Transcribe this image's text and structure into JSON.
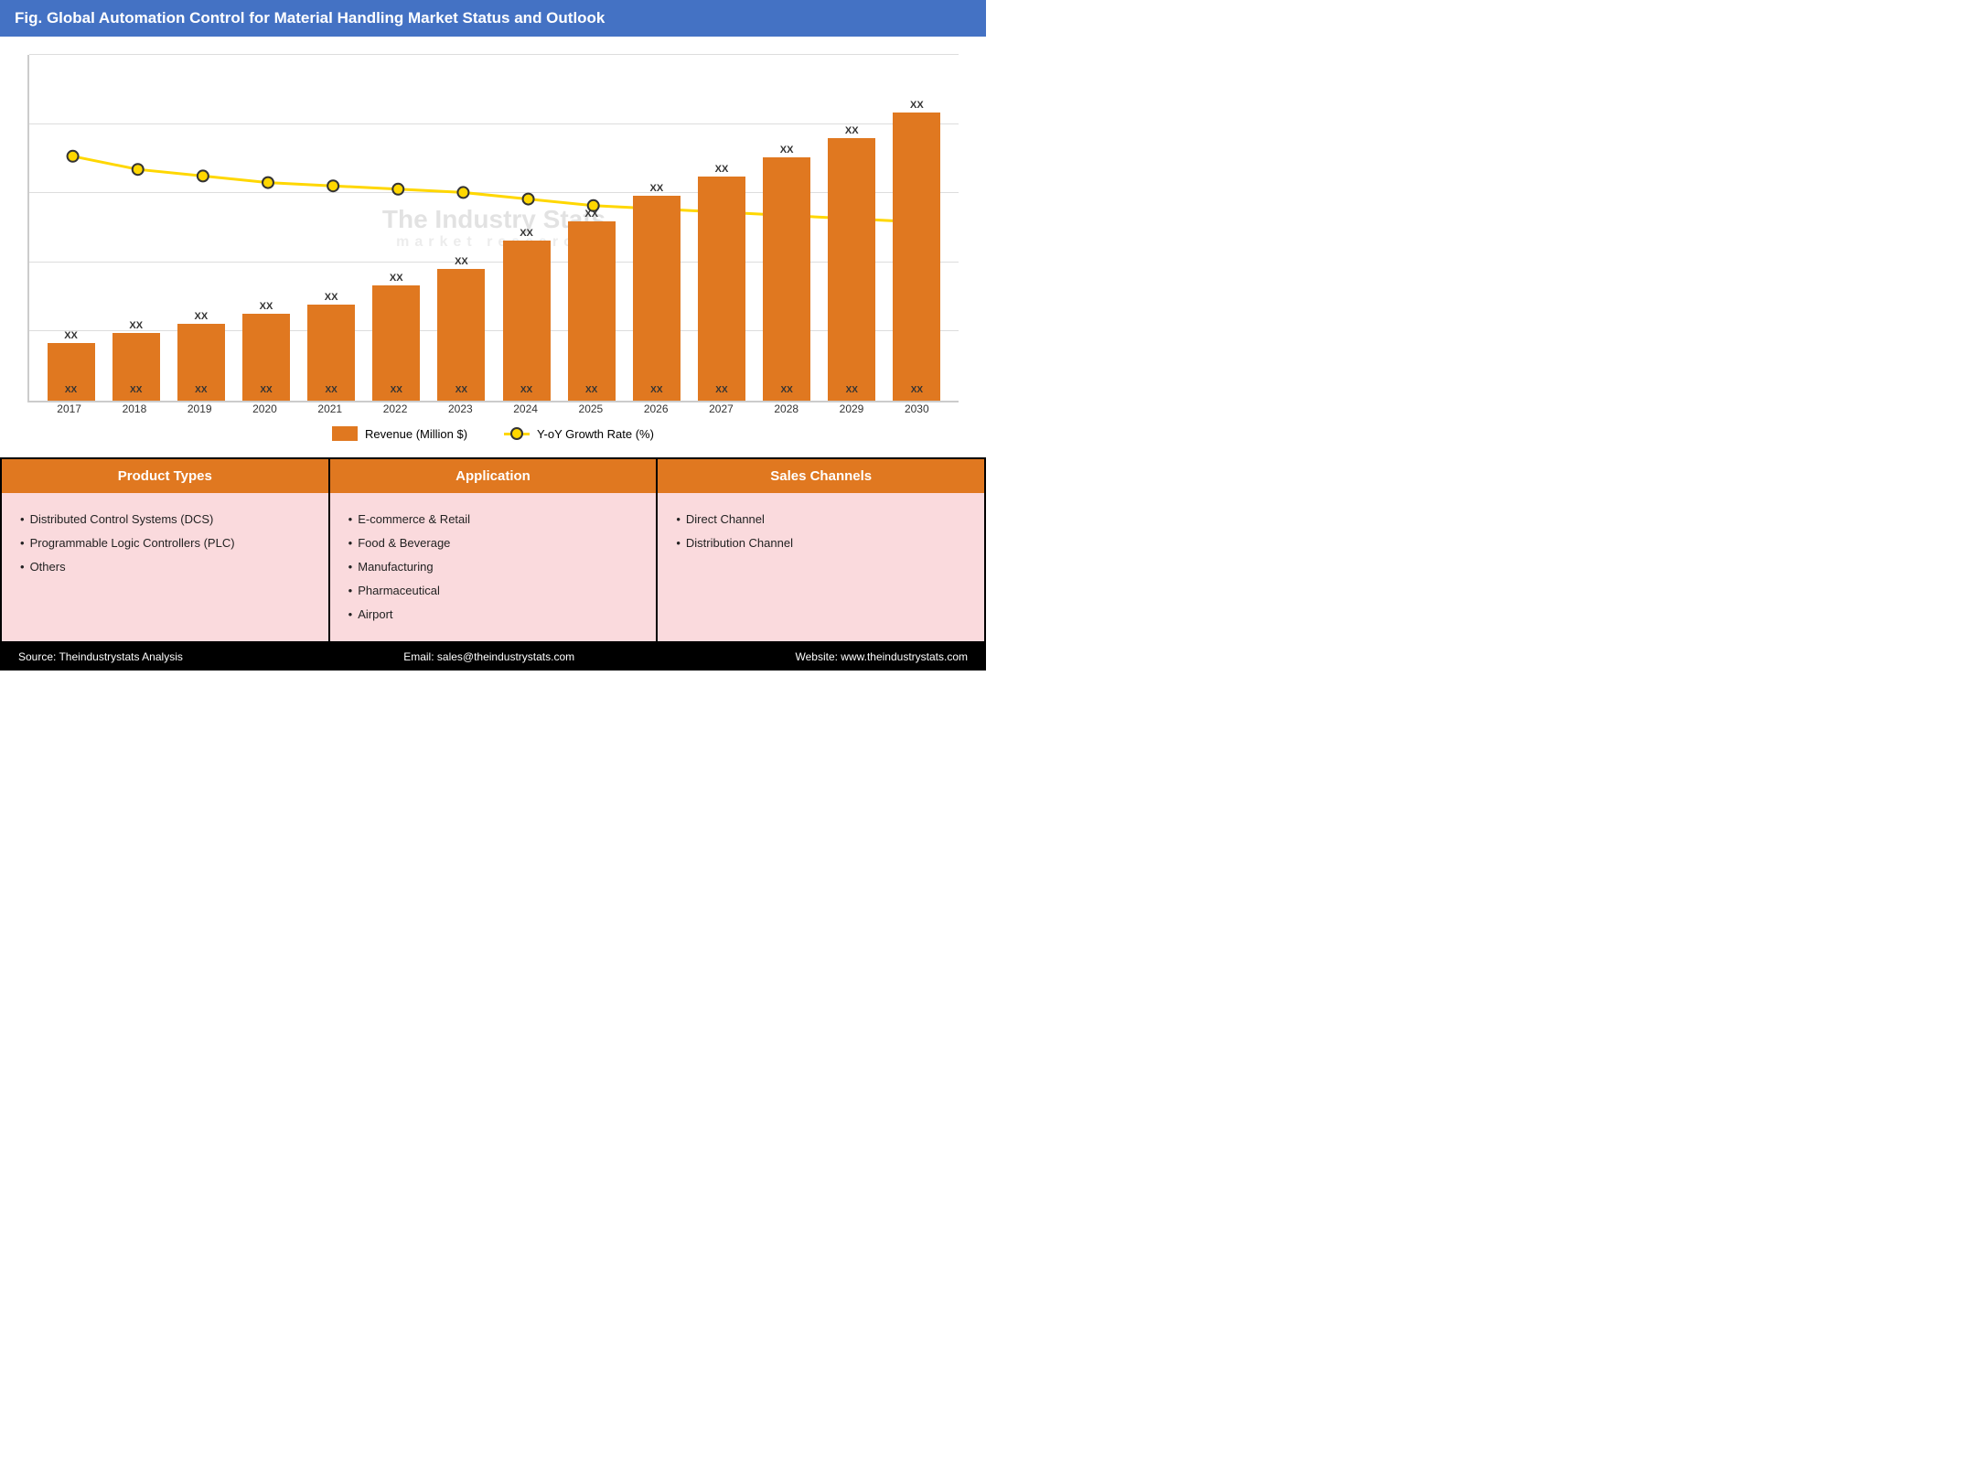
{
  "header": {
    "title": "Fig. Global Automation Control for Material Handling Market Status and Outlook"
  },
  "chart": {
    "years": [
      "2017",
      "2018",
      "2019",
      "2020",
      "2021",
      "2022",
      "2023",
      "2024",
      "2025",
      "2026",
      "2027",
      "2028",
      "2029",
      "2030"
    ],
    "bar_heights_pct": [
      18,
      21,
      24,
      27,
      30,
      36,
      41,
      50,
      56,
      64,
      70,
      76,
      82,
      90
    ],
    "top_labels": [
      "XX",
      "XX",
      "XX",
      "XX",
      "XX",
      "XX",
      "XX",
      "XX",
      "XX",
      "XX",
      "XX",
      "XX",
      "XX",
      "XX"
    ],
    "bottom_labels": [
      "XX",
      "XX",
      "XX",
      "XX",
      "XX",
      "XX",
      "XX",
      "XX",
      "XX",
      "XX",
      "XX",
      "XX",
      "XX",
      "XX"
    ],
    "line_heights_pct": [
      72,
      68,
      66,
      64,
      63,
      62,
      61,
      59,
      57,
      56,
      55,
      54,
      53,
      52
    ],
    "legend": {
      "bar_label": "Revenue (Million $)",
      "line_label": "Y-oY Growth Rate (%)"
    }
  },
  "watermark": {
    "company": "The Industry Stats",
    "sub": "market  research"
  },
  "panels": [
    {
      "id": "product-types",
      "header": "Product Types",
      "items": [
        "Distributed Control Systems (DCS)",
        "Programmable Logic Controllers (PLC)",
        "Others"
      ]
    },
    {
      "id": "application",
      "header": "Application",
      "items": [
        "E-commerce & Retail",
        "Food & Beverage",
        "Manufacturing",
        "Pharmaceutical",
        "Airport"
      ]
    },
    {
      "id": "sales-channels",
      "header": "Sales Channels",
      "items": [
        "Direct Channel",
        "Distribution Channel"
      ]
    }
  ],
  "footer": {
    "source": "Source: Theindustrystats Analysis",
    "email": "Email: sales@theindustrystats.com",
    "website": "Website: www.theindustrystats.com"
  }
}
